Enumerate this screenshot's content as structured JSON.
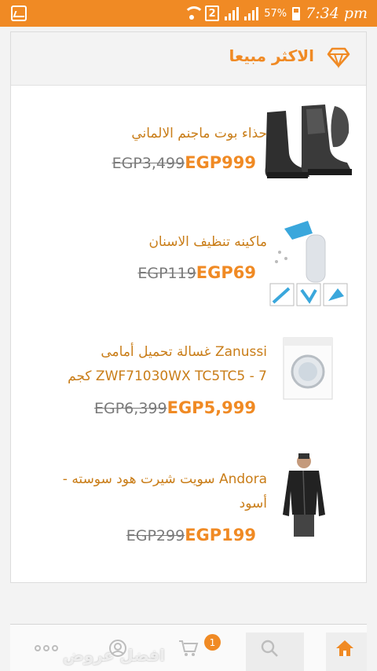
{
  "status_bar": {
    "sim_slot": "2",
    "battery_percent": "57%",
    "time": "7:34 pm"
  },
  "section": {
    "title": "الاكثر مبيعا",
    "icon": "diamond-icon"
  },
  "products": [
    {
      "title": "حذاء بوت ماجنم الالماني",
      "old_price": "EGP3,499",
      "new_price": "EGP999",
      "image": "black-boots"
    },
    {
      "title": "ماكينه تنظيف الاسنان",
      "old_price": "EGP119",
      "new_price": "EGP69",
      "image": "tooth-cleaner"
    },
    {
      "title": "Zanussi غسالة تحميل أمامى ZWF71030WX TC5TC5 - 7 كجم",
      "old_price": "EGP6,399",
      "new_price": "EGP5,999",
      "image": "washing-machine"
    },
    {
      "title": "Andora سويت شيرت هود سوسته - أسود",
      "old_price": "EGP299",
      "new_price": "EGP199",
      "image": "black-hoodie"
    }
  ],
  "bottom_nav": {
    "cart_count": "1",
    "banner_text": "افضل عروض",
    "items": [
      "more-icon",
      "user-icon",
      "cart-icon",
      "search-icon",
      "home-icon"
    ],
    "accent": "#f08a24"
  }
}
